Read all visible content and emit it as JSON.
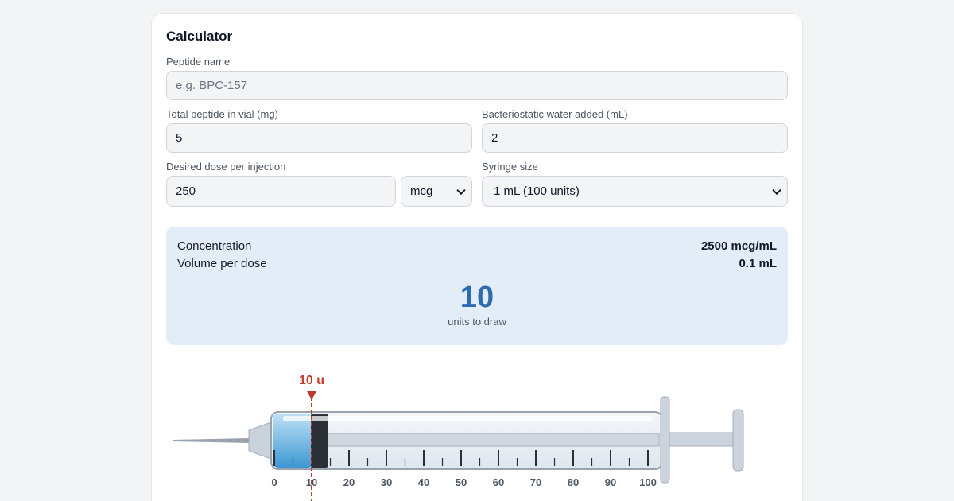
{
  "card": {
    "title": "Calculator"
  },
  "fields": {
    "peptide_name": {
      "label": "Peptide name",
      "value": "",
      "placeholder": "e.g. BPC-157"
    },
    "total_peptide": {
      "label": "Total peptide in vial (mg)",
      "value": "5"
    },
    "water": {
      "label": "Bacteriostatic water added (mL)",
      "value": "2"
    },
    "dose": {
      "label": "Desired dose per injection",
      "value": "250",
      "unit": "mcg"
    },
    "syringe": {
      "label": "Syringe size",
      "value": "1 mL (100 units)"
    }
  },
  "results": {
    "concentration_label": "Concentration",
    "concentration_value": "2500 mcg/mL",
    "volume_label": "Volume per dose",
    "volume_value": "0.1 mL",
    "units_value": "10",
    "units_caption": "units to draw"
  },
  "syringe_diagram": {
    "marker_label": "10 u",
    "draw_units": 10,
    "max_units": 100,
    "tick_labels": [
      "0",
      "10",
      "20",
      "30",
      "40",
      "50",
      "60",
      "70",
      "80",
      "90",
      "100"
    ],
    "colors": {
      "marker": "#c0392b",
      "liquid": "#5aaee0",
      "plunger_tip": "#2b2f36",
      "barrel_outline": "#9aa3ad",
      "rod": "#cbd3dc"
    }
  }
}
